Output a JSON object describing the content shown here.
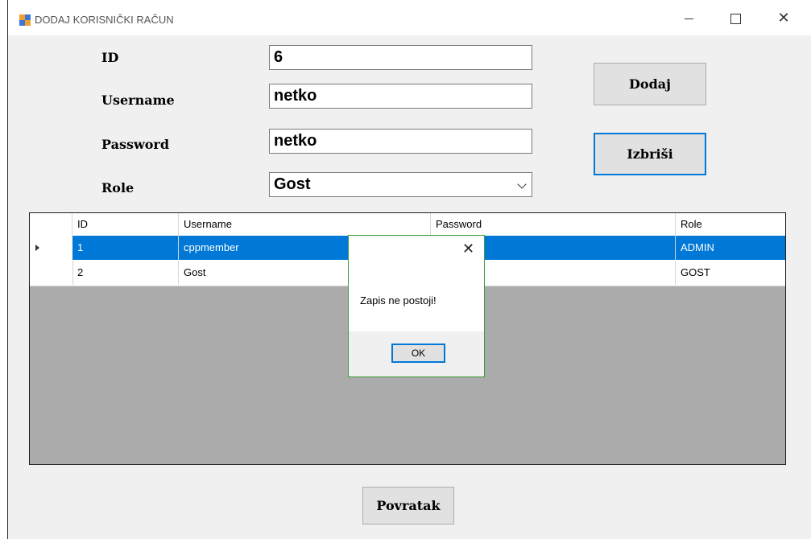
{
  "window": {
    "title": "DODAJ KORISNIČKI RAČUN",
    "minimize_glyph": "—",
    "maximize_glyph": "☐",
    "close_glyph": "✕"
  },
  "form": {
    "id_label": "ID",
    "username_label": "Username",
    "password_label": "Password",
    "role_label": "Role",
    "id_value": "6",
    "username_value": "netko",
    "password_value": "netko",
    "role_value": "Gost"
  },
  "buttons": {
    "add": "Dodaj",
    "delete": "Izbriši",
    "back": "Povratak"
  },
  "grid": {
    "columns": [
      "ID",
      "Username",
      "Password",
      "Role"
    ],
    "rows": [
      {
        "id": "1",
        "username": "cppmember",
        "password": "",
        "role": "ADMIN",
        "selected": true
      },
      {
        "id": "2",
        "username": "Gost",
        "password": "",
        "role": "GOST",
        "selected": false
      }
    ]
  },
  "dialog": {
    "message": "Zapis ne postoji!",
    "ok": "OK",
    "close_glyph": "✕"
  },
  "colors": {
    "selection": "#0078d7",
    "dialog_border": "#3c9a3c",
    "grid_background": "#ababab"
  }
}
